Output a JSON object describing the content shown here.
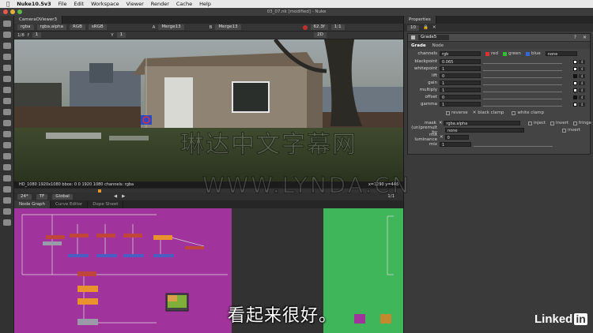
{
  "menubar": {
    "app": "Nuke10.5v3",
    "items": [
      "File",
      "Edit",
      "Workspace",
      "Viewer",
      "Render",
      "Cache",
      "Help"
    ]
  },
  "window": {
    "title": "03_07.nk [modified] - Nuke"
  },
  "viewer": {
    "tab": "CameraOViewer3",
    "channels": "rgba",
    "alpha": "rgba.alpha",
    "colorspace_a": "RGB",
    "colorspace_b": "sRGB",
    "input_a_label": "A",
    "input_a": "Merge13",
    "input_b_label": "B",
    "input_b": "Merge13",
    "zoom": "1:1",
    "fps": "62.3f",
    "frame_ratio": "1/8",
    "exposure_label": "f",
    "exposure": "1",
    "gamma_label": "Y",
    "gamma": "1",
    "mode": "2D",
    "info_left": "HD_1080 1920x1080  bbox: 0 0 1920 1080 channels: rgba",
    "info_right": "x=1290 y=446",
    "timeline_ticks": [
      "1",
      "50",
      "100",
      "150",
      "200",
      "250",
      "300",
      "350",
      "400",
      "450"
    ],
    "fps_field": "24*",
    "tf_label": "TF",
    "global_label": "Global",
    "frame_end": "1/1"
  },
  "nodegraph": {
    "tabs": [
      "Node Graph",
      "Curve Editor",
      "Dope Sheet"
    ]
  },
  "properties": {
    "tab": "Properties",
    "count": "10",
    "node_name": "Grade5",
    "tabs": [
      "Grade",
      "Node"
    ],
    "channels_label": "channels",
    "channels_value": "rgb",
    "channel_red": "red",
    "channel_green": "green",
    "channel_blue": "blue",
    "channel_none": "none",
    "rows": [
      {
        "label": "blackpoint",
        "value": "0.065"
      },
      {
        "label": "whitepoint",
        "value": "1"
      },
      {
        "label": "lift",
        "value": "0"
      },
      {
        "label": "gain",
        "value": "1"
      },
      {
        "label": "multiply",
        "value": "1"
      },
      {
        "label": "offset",
        "value": "0"
      },
      {
        "label": "gamma",
        "value": "1"
      }
    ],
    "reverse": "reverse",
    "black_clamp": "black clamp",
    "white_clamp": "white clamp",
    "mask_label": "mask",
    "mask_value": "rgba.alpha",
    "inject": "inject",
    "invert": "invert",
    "fringe": "fringe",
    "unpremult_label": "(un)premult by",
    "unpremult_value": "none",
    "unpremult_invert": "invert",
    "mix_luminance_label": "mix luminance",
    "mix_luminance_value": "0",
    "mix_label": "mix",
    "mix_value": "1"
  },
  "overlay": {
    "subtitle": "看起来很好。",
    "watermark_cn": "琳达中文字幕网",
    "watermark_url": "WWW.LYNDA.CN",
    "brand": "Linked",
    "brand_in": "in"
  },
  "colors": {
    "backdrop_purple": "#a1349c",
    "backdrop_green": "#3fb65a",
    "node_orange": "#e8932c",
    "node_blue": "#4a5fc4",
    "node_red": "#c0453a",
    "node_gray": "#9a9aa8"
  }
}
